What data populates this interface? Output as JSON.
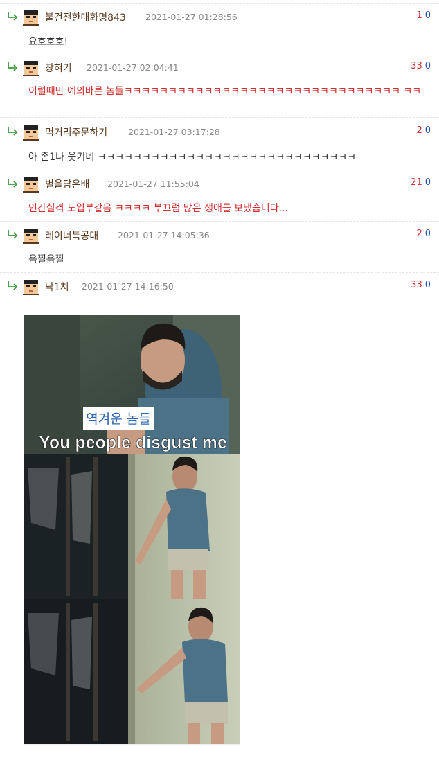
{
  "comments": [
    {
      "nick": "불건전한대화명843",
      "date": "2021-01-27 01:28:56",
      "up": "1",
      "down": "0",
      "text": "요호호호!",
      "red": false
    },
    {
      "nick": "창혀기",
      "date": "2021-01-27 02:04:41",
      "up": "33",
      "down": "0",
      "text": "이럴때만 예의바른 놈들ㅋㅋㅋㅋㅋㅋㅋㅋㅋㅋㅋㅋㅋㅋㅋㅋㅋㅋㅋㅋㅋㅋㅋㅋㅋㅋㅋㅋㅋㅋㅋ ㅋㅋ",
      "red": true
    },
    {
      "nick": "먹거리주문하기",
      "date": "2021-01-27 03:17:28",
      "up": "2",
      "down": "0",
      "text": "아 존1나 웃기네 ㅋㅋㅋㅋㅋㅋㅋㅋㅋㅋㅋㅋㅋㅋㅋㅋㅋㅋㅋㅋㅋㅋㅋㅋㅋㅋㅋㅋㅋ",
      "red": false
    },
    {
      "nick": "별을담은배",
      "date": "2021-01-27 11:55:04",
      "up": "21",
      "down": "0",
      "text": "인간실격 도입부같음 ㅋㅋㅋㅋ 부끄럼 많은 생애를 보냈습니다...",
      "red": true
    },
    {
      "nick": "레이너특공대",
      "date": "2021-01-27 14:05:36",
      "up": "2",
      "down": "0",
      "text": "음찔음찔",
      "red": false
    },
    {
      "nick": "닥1쳐",
      "date": "2021-01-27 14:16:50",
      "up": "33",
      "down": "0",
      "text": "",
      "red": false
    }
  ],
  "meme": {
    "caption_ko": "역겨운 놈들",
    "caption_en": "You people disgust me"
  },
  "colors": {
    "upvote": "#d0302f",
    "downvote": "#2b4fb0",
    "nick": "#5a3a1e"
  }
}
